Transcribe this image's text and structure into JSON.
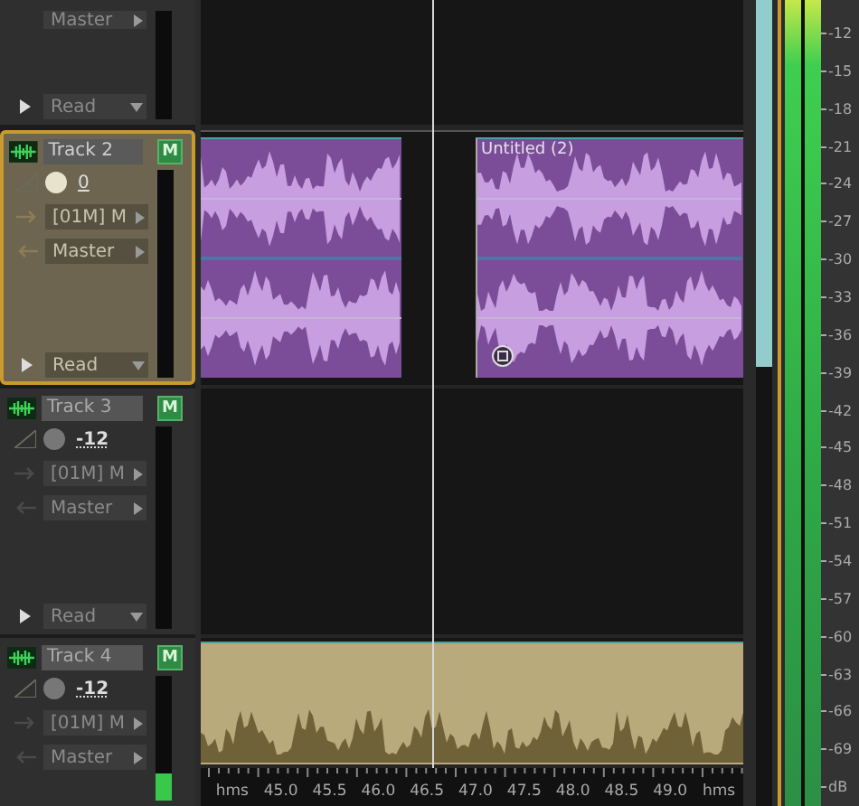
{
  "tracks": [
    {
      "output": "Master",
      "automation": "Read",
      "selected": false
    },
    {
      "name": "Track 2",
      "mute": "M",
      "volume": "0",
      "input": "[01M] M",
      "output": "Master",
      "automation": "Read",
      "selected": true,
      "color": "#7b4d98",
      "clips": [
        {
          "kind": "audio"
        },
        {
          "kind": "audio",
          "title": "Untitled (2)"
        }
      ]
    },
    {
      "name": "Track 3",
      "mute": "M",
      "volume": "-12",
      "input": "[01M] M",
      "output": "Master",
      "automation": "Read",
      "selected": false
    },
    {
      "name": "Track 4",
      "mute": "M",
      "volume": "-12",
      "input": "[01M] M",
      "output": "Master",
      "selected": false,
      "meter": {
        "level": 0.22
      },
      "color": "#b9aa7c",
      "clips": [
        {
          "kind": "audio"
        }
      ]
    }
  ],
  "ruler": [
    "hms",
    "45.0",
    "45.5",
    "46.0",
    "46.5",
    "47.0",
    "47.5",
    "48.0",
    "48.5",
    "49.0",
    "hms"
  ],
  "master_meter": {
    "level": 1
  },
  "db_scale": [
    "-12",
    "-15",
    "-18",
    "-21",
    "-24",
    "-27",
    "-30",
    "-33",
    "-36",
    "-39",
    "-42",
    "-45",
    "-48",
    "-51",
    "-54",
    "-57",
    "-60",
    "-63",
    "-66",
    "-69",
    "dB"
  ]
}
